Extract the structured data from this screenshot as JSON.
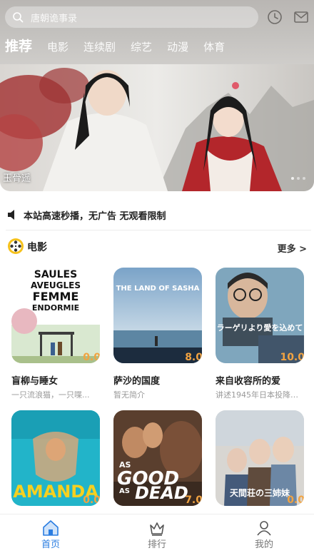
{
  "header": {
    "search_placeholder": "唐朝诡事录",
    "tabs": [
      {
        "label": "推荐"
      },
      {
        "label": "电影"
      },
      {
        "label": "连续剧"
      },
      {
        "label": "综艺"
      },
      {
        "label": "动漫"
      },
      {
        "label": "体育"
      }
    ],
    "icons": [
      "search-icon",
      "history-icon",
      "message-icon"
    ]
  },
  "banner": {
    "caption": "玉骨遥"
  },
  "notice": {
    "text": "本站高速秒播，无广告 无观看限制",
    "icon": "speaker-icon"
  },
  "section": {
    "title": "电影",
    "more_label": "更多 >",
    "icon": "film-reel-icon"
  },
  "movies": [
    {
      "title": "盲柳与睡女",
      "desc": "一只流浪猫，一只喋...",
      "score": "0.0",
      "poster_text": "SAULES AVEUGLES FEMME ENDORMIE"
    },
    {
      "title": "萨沙的国度",
      "desc": "暂无简介",
      "score": "8.0",
      "poster_text": "THE LAND OF SASHA"
    },
    {
      "title": "来自收容所的爱",
      "desc": "讲述1945年日本投降后，...",
      "score": "10.0",
      "poster_text": "ラーゲリより愛を込めて"
    },
    {
      "title": "",
      "desc": "",
      "score": "0.0",
      "poster_text": "AMANDA"
    },
    {
      "title": "",
      "desc": "",
      "score": "7.0",
      "poster_text": "AS GOOD AS DEAD"
    },
    {
      "title": "",
      "desc": "",
      "score": "0.0",
      "poster_text": "天間荘の三姉妹"
    }
  ],
  "bottom_nav": [
    {
      "label": "首页",
      "icon": "home-icon",
      "active": true
    },
    {
      "label": "排行",
      "icon": "ranking-icon",
      "active": false
    },
    {
      "label": "我的",
      "icon": "profile-icon",
      "active": false
    }
  ],
  "colors": {
    "accent": "#2a7de1",
    "score": "#f2a341"
  }
}
